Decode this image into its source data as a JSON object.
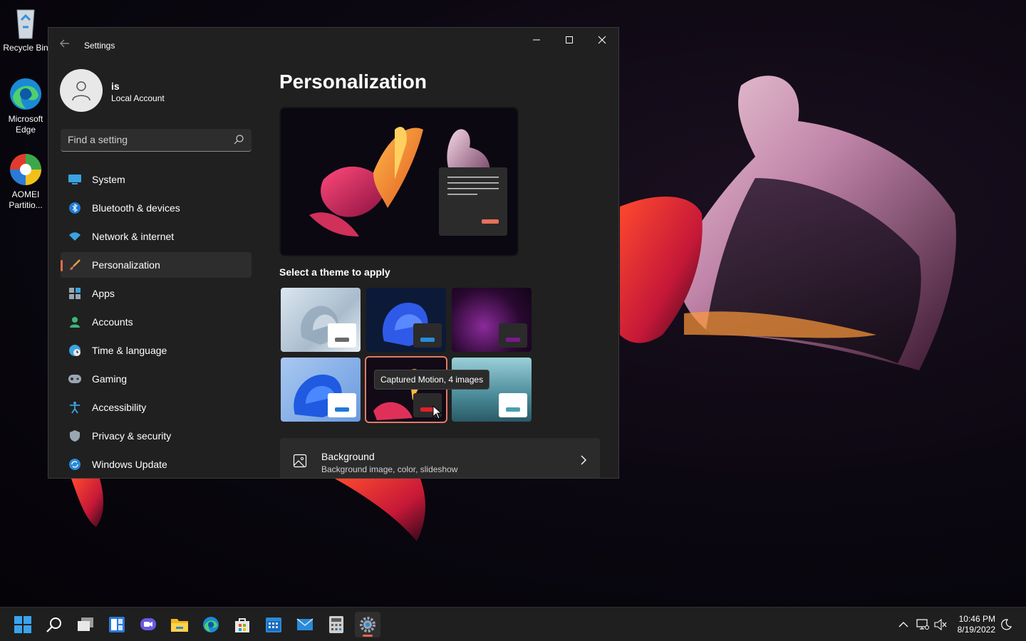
{
  "desktop": {
    "icons": [
      {
        "label": "Recycle Bin",
        "icon": "recycle-bin-icon"
      },
      {
        "label": "Microsoft Edge",
        "icon": "edge-icon"
      },
      {
        "label": "AOMEI Partitio...",
        "icon": "aomei-partition-icon"
      }
    ]
  },
  "window": {
    "title": "Settings",
    "controls": {
      "minimize": "—",
      "maximize": "☐",
      "close": "✕"
    }
  },
  "profile": {
    "name": "is",
    "account_type": "Local Account"
  },
  "search": {
    "placeholder": "Find a setting"
  },
  "nav": {
    "items": [
      {
        "label": "System",
        "icon": "system-icon"
      },
      {
        "label": "Bluetooth & devices",
        "icon": "bluetooth-icon"
      },
      {
        "label": "Network & internet",
        "icon": "wifi-icon"
      },
      {
        "label": "Personalization",
        "icon": "brush-icon",
        "active": true
      },
      {
        "label": "Apps",
        "icon": "apps-icon"
      },
      {
        "label": "Accounts",
        "icon": "person-icon"
      },
      {
        "label": "Time & language",
        "icon": "globe-clock-icon"
      },
      {
        "label": "Gaming",
        "icon": "gamepad-icon"
      },
      {
        "label": "Accessibility",
        "icon": "accessibility-icon"
      },
      {
        "label": "Privacy & security",
        "icon": "shield-icon"
      },
      {
        "label": "Windows Update",
        "icon": "update-icon"
      }
    ]
  },
  "main": {
    "title": "Personalization",
    "themes_label": "Select a theme to apply",
    "themes": [
      {
        "name": "light-bloom",
        "selected": false
      },
      {
        "name": "dark-bloom",
        "selected": false
      },
      {
        "name": "glow",
        "selected": false
      },
      {
        "name": "windows-light",
        "selected": false
      },
      {
        "name": "captured-motion",
        "selected": true
      },
      {
        "name": "flow",
        "selected": false
      }
    ],
    "tooltip": "Captured Motion, 4 images",
    "background_row": {
      "title": "Background",
      "subtitle": "Background image, color, slideshow"
    }
  },
  "taskbar": {
    "apps": [
      "start-icon",
      "search-icon",
      "task-view-icon",
      "widgets-icon",
      "chat-icon",
      "file-explorer-icon",
      "edge-icon",
      "store-icon",
      "calendar-icon",
      "mail-icon",
      "calculator-icon",
      "settings-icon"
    ],
    "active_app": "settings-icon",
    "clock": {
      "time": "10:46 PM",
      "date": "8/19/2022"
    }
  },
  "colors": {
    "accent": "#e06b4a",
    "window_bg": "#202020",
    "taskbar_bg": "#1f1f1f"
  }
}
